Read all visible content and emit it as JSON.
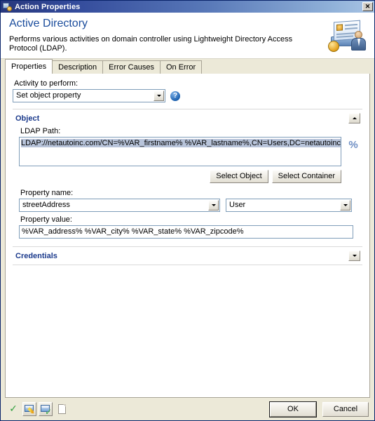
{
  "window": {
    "title": "Action Properties",
    "close_label": "✕",
    "icon": "action-properties-icon"
  },
  "header": {
    "title": "Active Directory",
    "subtitle": "Performs various activities on domain controller using Lightweight Directory Access Protocol (LDAP).",
    "icon": "active-directory-icon"
  },
  "tabs": [
    {
      "label": "Properties",
      "active": true
    },
    {
      "label": "Description",
      "active": false
    },
    {
      "label": "Error Causes",
      "active": false
    },
    {
      "label": "On Error",
      "active": false
    }
  ],
  "properties_tab": {
    "activity": {
      "label": "Activity to perform:",
      "value": "Set object property",
      "help_icon": "help-question-icon"
    },
    "object_section": {
      "title": "Object",
      "toggle_icon": "chevron-up-icon",
      "expanded": true,
      "ldap_path": {
        "label": "LDAP Path:",
        "value": "LDAP://netautoinc.com/CN=%VAR_firstname% %VAR_lastname%,CN=Users,DC=netautoinc,DC=com",
        "selected": true,
        "variable_icon": "percent-variable-icon"
      },
      "buttons": [
        {
          "label": "Select Object"
        },
        {
          "label": "Select Container"
        }
      ],
      "property_name": {
        "label": "Property name:",
        "value": "streetAddress"
      },
      "object_class": {
        "value": "User"
      },
      "property_value": {
        "label": "Property value:",
        "value": "%VAR_address% %VAR_city% %VAR_state% %VAR_zipcode%"
      }
    },
    "credentials_section": {
      "title": "Credentials",
      "toggle_icon": "chevron-down-icon",
      "expanded": false
    }
  },
  "footer": {
    "tools": [
      {
        "name": "validate-icon",
        "glyph": "✓"
      },
      {
        "name": "edit-action-icon"
      },
      {
        "name": "test-action-icon"
      },
      {
        "name": "new-document-icon"
      }
    ],
    "ok_label": "OK",
    "cancel_label": "Cancel"
  },
  "colors": {
    "title_start": "#28387c",
    "title_end": "#a8c4e4",
    "heading_blue": "#1a4c9c",
    "section_blue": "#1b3a8c",
    "selection_blue": "#b8c4da",
    "dialog_face": "#ece9d8"
  }
}
